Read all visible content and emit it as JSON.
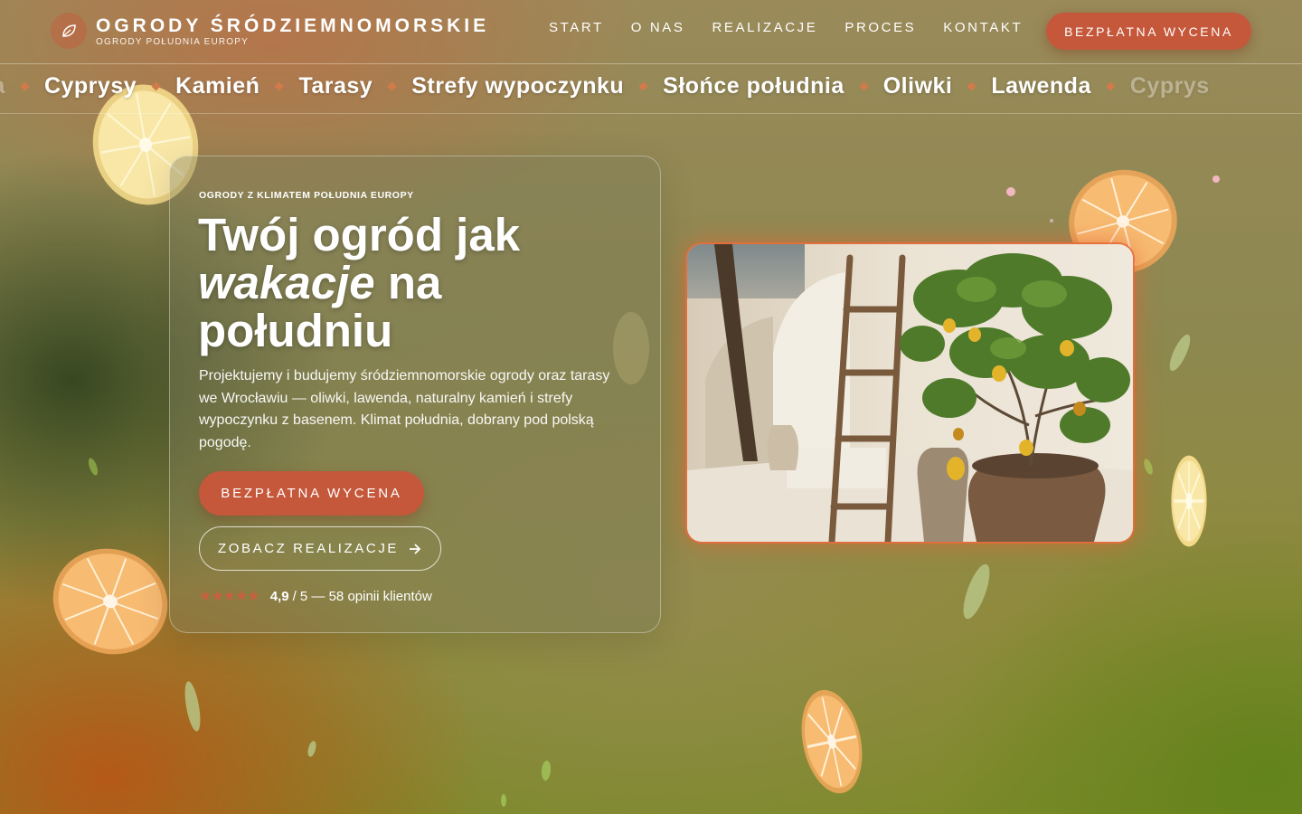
{
  "brand": {
    "title": "OGRODY ŚRÓDZIEMNOMORSKIE",
    "subtitle": "OGRODY POŁUDNIA EUROPY"
  },
  "nav": {
    "items": [
      "START",
      "O NAS",
      "REALIZACJE",
      "PROCES",
      "KONTAKT"
    ],
    "cta": "BEZPŁATNA WYCENA"
  },
  "marquee": {
    "items": [
      "nda",
      "Cyprysy",
      "Kamień",
      "Tarasy",
      "Strefy wypoczynku",
      "Słońce południa",
      "Oliwki",
      "Lawenda",
      "Cyprys"
    ]
  },
  "hero": {
    "eyebrow": "OGRODY Z KLIMATEM POŁUDNIA EUROPY",
    "headline_line1": "Twój ogród jak",
    "headline_italic": "wakacje",
    "headline_rest": " na",
    "headline_line3": "południu",
    "description": "Projektujemy i budujemy śródziemnomorskie ogrody oraz tarasy we Wrocławiu — oliwki, lawenda, naturalny kamień i strefy wypoczynku z basenem. Klimat południa, dobrany pod polską pogodę.",
    "primary_cta": "BEZPŁATNA WYCENA",
    "secondary_cta": "ZOBACZ REALIZACJE",
    "rating_score": "4,9",
    "rating_text": "/ 5 — 58 opinii klientów",
    "stars": "★★★★★"
  },
  "colors": {
    "accent": "#c5573a",
    "star": "#c8603f",
    "photo_glow": "#e66e3c"
  },
  "icons": {
    "logo": "leaf-icon",
    "arrow": "arrow-right-icon",
    "photo": "lemon-tree-photo"
  }
}
